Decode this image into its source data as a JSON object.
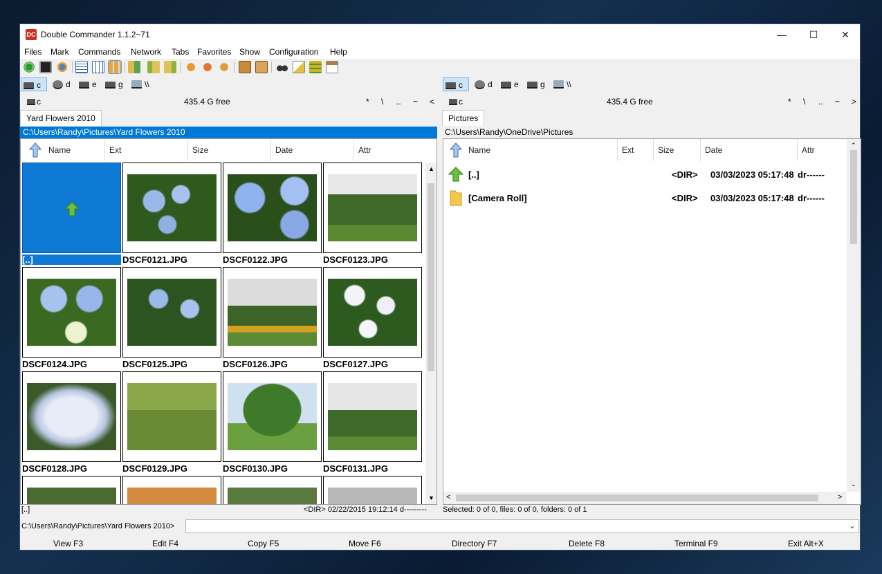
{
  "window": {
    "title": "Double Commander 1.1.2~71",
    "controls": [
      "—",
      "☐",
      "✕"
    ]
  },
  "menu": [
    "Files",
    "Mark",
    "Commands",
    "Network",
    "Tabs",
    "Favorites",
    "Show",
    "Configuration",
    "Help"
  ],
  "toolbar": {
    "icons": [
      "refresh-icon",
      "terminal-icon",
      "options-icon",
      "brief-view-icon",
      "full-view-icon",
      "thumbnail-view-icon",
      "compare-icon",
      "copy-left-icon",
      "copy-right-icon",
      "multi-rename-icon",
      "sync-dirs-icon",
      "edit-comment-icon",
      "pack-icon",
      "unpack-icon",
      "search-icon",
      "edit-icon",
      "column-set-icon",
      "clipboard-icon"
    ]
  },
  "left": {
    "drives": [
      "c",
      "d",
      "e",
      "g",
      "\\\\"
    ],
    "drive_label": "c",
    "free": "435.4 G free",
    "nav": [
      "*",
      "\\",
      "..",
      "~",
      "<"
    ],
    "tab": "Yard Flowers 2010",
    "path": "C:\\Users\\Randy\\Pictures\\Yard Flowers 2010",
    "headers": [
      "Name",
      "Ext",
      "Size",
      "Date",
      "Attr"
    ],
    "thumbs": [
      "[..]",
      "DSCF0121.JPG",
      "DSCF0122.JPG",
      "DSCF0123.JPG",
      "DSCF0124.JPG",
      "DSCF0125.JPG",
      "DSCF0126.JPG",
      "DSCF0127.JPG",
      "DSCF0128.JPG",
      "DSCF0129.JPG",
      "DSCF0130.JPG",
      "DSCF0131.JPG"
    ],
    "status": {
      "name": "[..]",
      "info": "<DIR>  02/22/2015 19:12:14  d---------"
    }
  },
  "right": {
    "drives": [
      "c",
      "d",
      "e",
      "g",
      "\\\\"
    ],
    "drive_label": "c",
    "free": "435.4 G free",
    "nav": [
      "*",
      "\\",
      "..",
      "~",
      ">"
    ],
    "tab": "Pictures",
    "path": "C:\\Users\\Randy\\OneDrive\\Pictures",
    "headers": [
      "Name",
      "Ext",
      "Size",
      "Date",
      "Attr"
    ],
    "rows": [
      {
        "name": "[..]",
        "size": "<DIR>",
        "date": "03/03/2023 05:17:48",
        "attr": "dr------"
      },
      {
        "name": "[Camera Roll]",
        "size": "<DIR>",
        "date": "03/03/2023 05:17:48",
        "attr": "dr------"
      }
    ],
    "status": "Selected: 0 of 0, files: 0 of 0, folders: 0 of 1"
  },
  "cmdline": {
    "prompt": "C:\\Users\\Randy\\Pictures\\Yard Flowers 2010>",
    "value": ""
  },
  "fkeys": [
    "View F3",
    "Edit F4",
    "Copy F5",
    "Move F6",
    "Directory F7",
    "Delete F8",
    "Terminal F9",
    "Exit Alt+X"
  ]
}
